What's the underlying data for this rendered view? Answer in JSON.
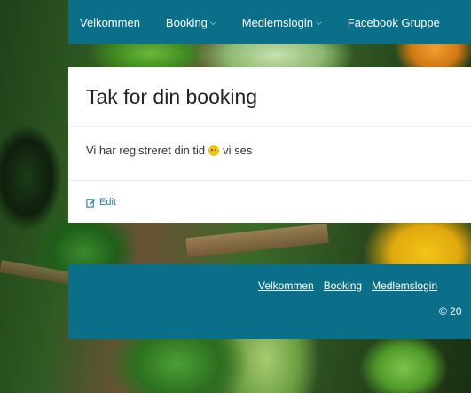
{
  "nav": {
    "items": [
      {
        "label": "Velkommen",
        "dropdown": false
      },
      {
        "label": "Booking",
        "dropdown": true
      },
      {
        "label": "Medlemslogin",
        "dropdown": true
      },
      {
        "label": "Facebook Gruppe",
        "dropdown": false
      }
    ]
  },
  "page": {
    "title": "Tak for din booking",
    "text_before": "Vi har registreret din tid",
    "text_after": "vi ses",
    "edit_label": "Edit"
  },
  "footer": {
    "links": [
      "Velkommen",
      "Booking",
      "Medlemslogin"
    ],
    "copyright": "© 20"
  },
  "colors": {
    "primary": "#0b6f8a",
    "link": "#1a7da0"
  }
}
